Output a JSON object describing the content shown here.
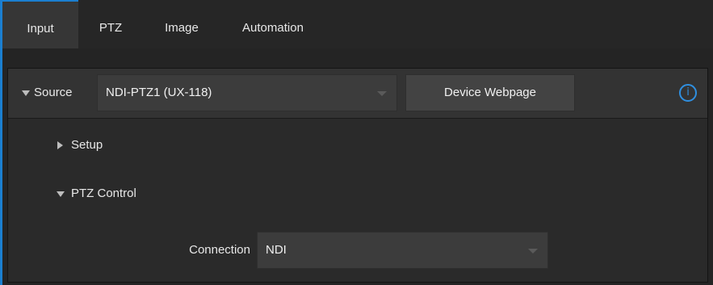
{
  "tabs": [
    {
      "label": "Input",
      "active": true
    },
    {
      "label": "PTZ",
      "active": false
    },
    {
      "label": "Image",
      "active": false
    },
    {
      "label": "Automation",
      "active": false
    }
  ],
  "source": {
    "label": "Source",
    "selected": "NDI-PTZ1 (UX-118)",
    "device_webpage_label": "Device Webpage",
    "info_glyph": "i"
  },
  "setup": {
    "label": "Setup",
    "expanded": false
  },
  "ptz_control": {
    "label": "PTZ Control",
    "expanded": true,
    "connection_label": "Connection",
    "connection_value": "NDI"
  },
  "colors": {
    "accent": "#1b7fd0",
    "info": "#2f8fe0",
    "background": "#242424",
    "panel": "#2a2a2a"
  },
  "icons": {
    "collapse": "triangle-down-icon",
    "expand": "triangle-right-icon",
    "dropdown": "chevron-down-icon",
    "info": "info-icon"
  }
}
